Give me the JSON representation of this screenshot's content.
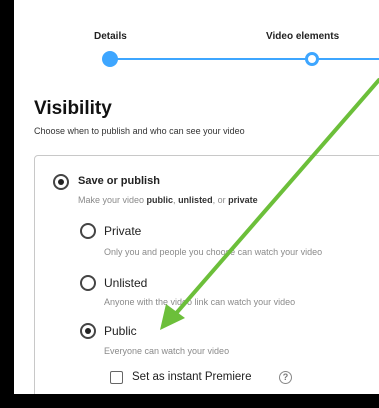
{
  "stepper": {
    "steps": [
      {
        "label": "Details",
        "state": "done"
      },
      {
        "label": "Video elements",
        "state": "next"
      }
    ],
    "accent_color": "#3ea6ff"
  },
  "visibility": {
    "title": "Visibility",
    "subtitle": "Choose when to publish and who can see your video",
    "save_or_publish": {
      "label": "Save or publish",
      "desc_prefix": "Make your video ",
      "desc_public": "public",
      "desc_sep1": ", ",
      "desc_unlisted": "unlisted",
      "desc_sep2": ", or ",
      "desc_private": "private",
      "selected": true
    },
    "options": [
      {
        "label": "Private",
        "desc": "Only you and people you choose can watch your video",
        "selected": false
      },
      {
        "label": "Unlisted",
        "desc": "Anyone with the video link can watch your video",
        "selected": false
      },
      {
        "label": "Public",
        "desc": "Everyone can watch your video",
        "selected": true
      }
    ],
    "premiere": {
      "label": "Set as instant Premiere",
      "checked": false,
      "help_icon": "question-circle-icon"
    }
  },
  "annotation": {
    "arrow_color": "#6cbf3a"
  }
}
